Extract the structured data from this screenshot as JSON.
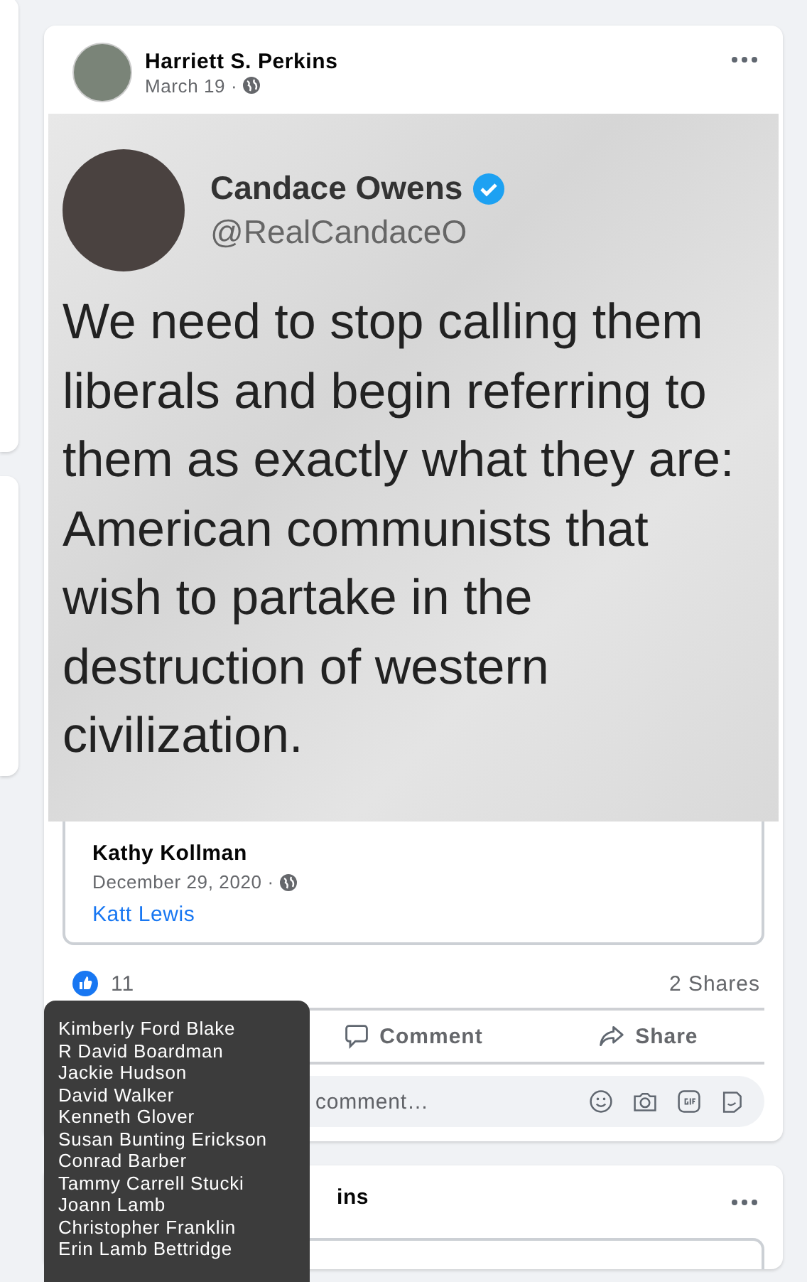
{
  "post": {
    "author": "Harriett S. Perkins",
    "date": "March 19 ·",
    "image": {
      "tweet_name": "Candace Owens",
      "tweet_verified": true,
      "tweet_handle": "@RealCandaceO",
      "tweet_text": "We need to stop calling them liberals and begin referring to them as exactly what they are: American communists that wish to partake in the destruction of western civilization."
    },
    "shared_from": {
      "author": "Kathy Kollman",
      "date": "December 29, 2020 ·",
      "link": "Katt Lewis"
    },
    "reactions": {
      "count": "11",
      "shares": "2 Shares"
    },
    "actions": [
      {
        "kind": "comment",
        "label": "Comment"
      },
      {
        "kind": "share",
        "label": "Share"
      }
    ],
    "comment_field": {
      "placeholder": "comment…"
    }
  },
  "next_post": {
    "author": "ins"
  },
  "likers_tooltip": [
    "Kimberly Ford Blake",
    "R David Boardman",
    "Jackie Hudson",
    "David Walker",
    "Kenneth Glover",
    "Susan Bunting Erickson",
    "Conrad Barber",
    "Tammy Carrell Stucki",
    "Joann Lamb",
    "Christopher Franklin",
    "Erin Lamb Bettridge"
  ]
}
